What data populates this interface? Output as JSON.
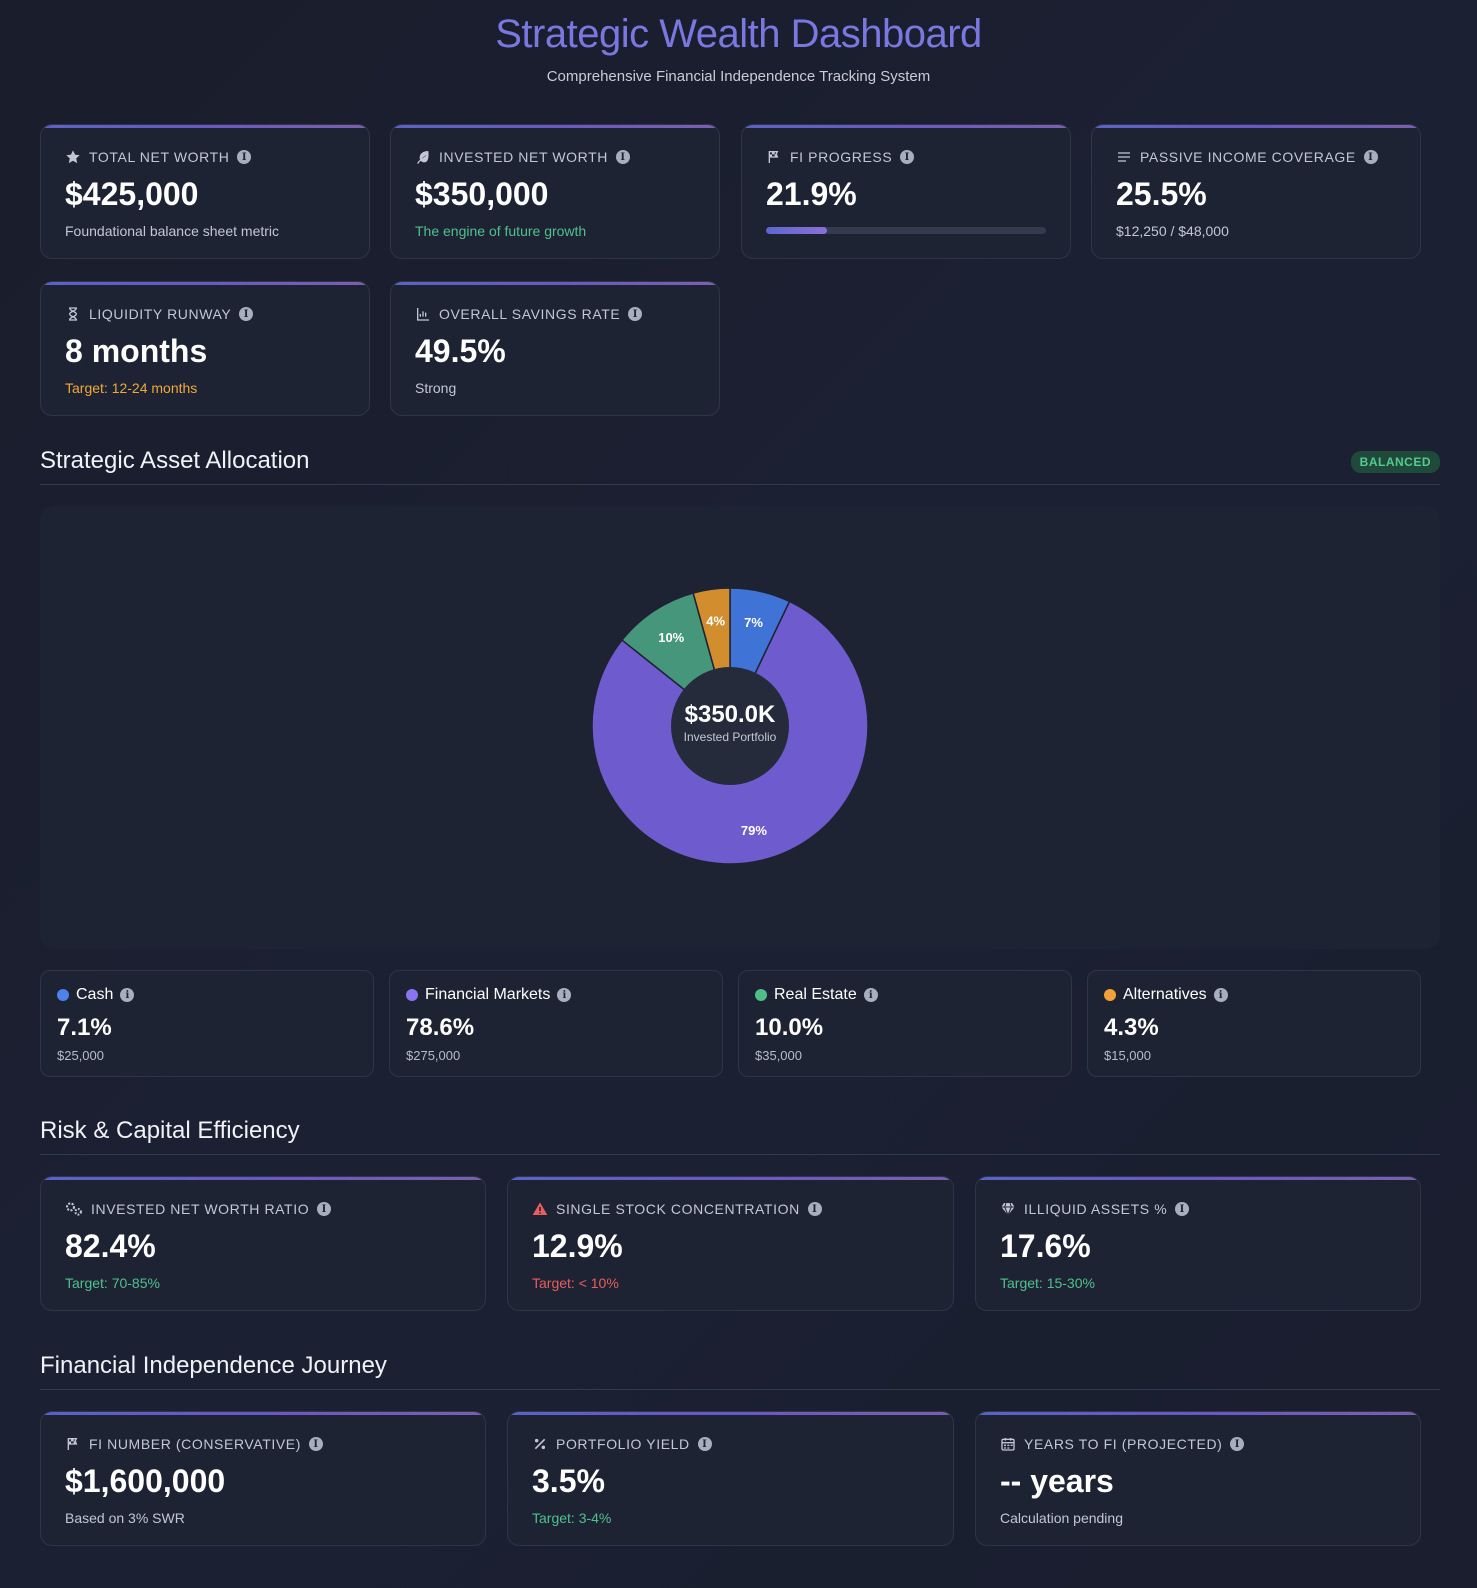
{
  "header": {
    "title": "Strategic Wealth Dashboard",
    "subtitle": "Comprehensive Financial Independence Tracking System"
  },
  "metrics": {
    "total_net_worth": {
      "label": "TOTAL NET WORTH",
      "value": "$425,000",
      "sub": "Foundational balance sheet metric",
      "icon": "star-icon"
    },
    "invested_net_worth": {
      "label": "INVESTED NET WORTH",
      "value": "$350,000",
      "sub": "The engine of future growth",
      "icon": "seedling-icon"
    },
    "fi_progress": {
      "label": "FI PROGRESS",
      "value": "21.9%",
      "progress": 21.9,
      "icon": "flag-icon"
    },
    "passive_income": {
      "label": "PASSIVE INCOME COVERAGE",
      "value": "25.5%",
      "sub": "$12,250 / $48,000",
      "icon": "bars-icon"
    },
    "liquidity_runway": {
      "label": "LIQUIDITY RUNWAY",
      "value": "8 months",
      "sub": "Target: 12-24 months",
      "icon": "hourglass-icon"
    },
    "savings_rate": {
      "label": "OVERALL SAVINGS RATE",
      "value": "49.5%",
      "sub": "Strong",
      "icon": "chart-icon"
    }
  },
  "allocation": {
    "title": "Strategic Asset Allocation",
    "badge": "BALANCED",
    "center_value": "$350.0K",
    "center_label": "Invested Portfolio",
    "colors": {
      "cash": "#3f74d6",
      "markets": "#6e5ccf",
      "real_estate": "#45967a",
      "alternatives": "#d18d2e"
    },
    "items": [
      {
        "name": "Cash",
        "pct": "7.1%",
        "amount": "$25,000",
        "color": "#4b82ec"
      },
      {
        "name": "Financial Markets",
        "pct": "78.6%",
        "amount": "$275,000",
        "color": "#8a74f0"
      },
      {
        "name": "Real Estate",
        "pct": "10.0%",
        "amount": "$35,000",
        "color": "#4fbf87"
      },
      {
        "name": "Alternatives",
        "pct": "4.3%",
        "amount": "$15,000",
        "color": "#f0a13a"
      }
    ]
  },
  "chart_data": {
    "type": "pie",
    "categories": [
      "Cash",
      "Financial Markets",
      "Real Estate",
      "Alternatives"
    ],
    "values": [
      7.1,
      78.6,
      10.0,
      4.3
    ],
    "labels": [
      "7%",
      "79%",
      "10%",
      "4%"
    ]
  },
  "risk": {
    "title": "Risk & Capital Efficiency",
    "invested_ratio": {
      "label": "INVESTED NET WORTH RATIO",
      "value": "82.4%",
      "sub": "Target: 70-85%",
      "icon": "gears-icon"
    },
    "single_stock": {
      "label": "SINGLE STOCK CONCENTRATION",
      "value": "12.9%",
      "sub": "Target: < 10%",
      "icon": "warning-icon"
    },
    "illiquid": {
      "label": "ILLIQUID ASSETS %",
      "value": "17.6%",
      "sub": "Target: 15-30%",
      "icon": "gem-icon"
    }
  },
  "fi": {
    "title": "Financial Independence Journey",
    "fi_number": {
      "label": "FI NUMBER (CONSERVATIVE)",
      "value": "$1,600,000",
      "sub": "Based on 3% SWR",
      "icon": "flag-icon"
    },
    "yield": {
      "label": "PORTFOLIO YIELD",
      "value": "3.5%",
      "sub": "Target: 3-4%",
      "icon": "percent-icon"
    },
    "years": {
      "label": "YEARS TO FI (PROJECTED)",
      "value": "-- years",
      "sub": "Calculation pending",
      "icon": "calendar-icon"
    }
  }
}
